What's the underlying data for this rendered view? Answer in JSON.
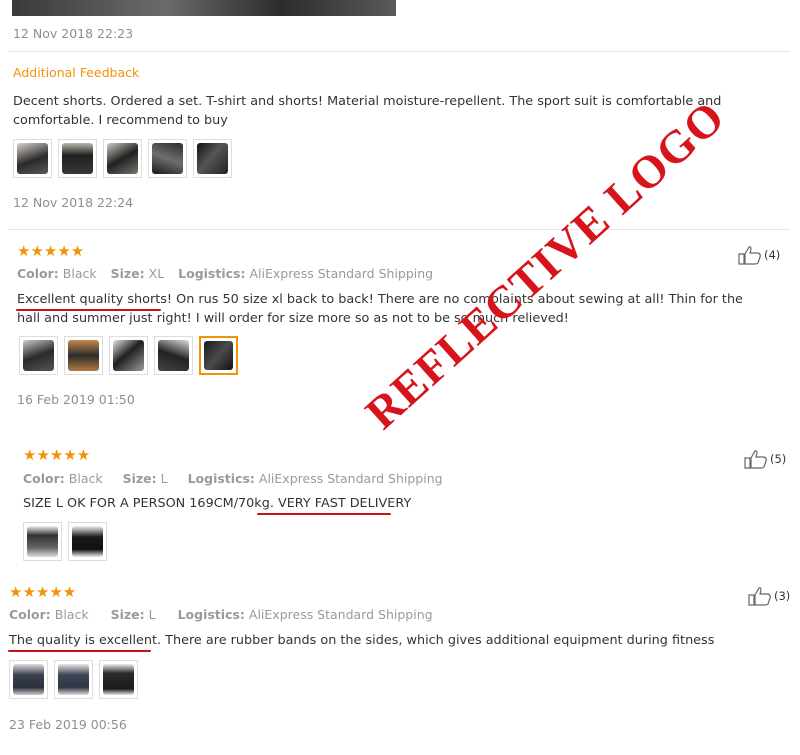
{
  "review0": {
    "date": "12 Nov 2018 22:23",
    "additional_feedback_title": "Additional Feedback",
    "additional_text": "Decent shorts. Ordered a set. T-shirt and shorts! Material moisture-repellent. The sport suit is comfortable and comfortable. I recommend to buy",
    "additional_date": "12 Nov 2018 22:24"
  },
  "review1": {
    "stars": "★★★★★",
    "color_label": "Color:",
    "color_value": "Black",
    "size_label": "Size:",
    "size_value": "XL",
    "logistics_label": "Logistics:",
    "logistics_value": "AliExpress Standard Shipping",
    "text": "Excellent quality shorts! On rus 50 size xl back to back! There are no complaints about sewing at all! Thin for the hall and summer just right! I will order for size more so as not to be so much relieved!",
    "helpful_count": "(4)",
    "date": "16 Feb 2019 01:50"
  },
  "review2": {
    "stars": "★★★★★",
    "color_label": "Color:",
    "color_value": "Black",
    "size_label": "Size:",
    "size_value": "L",
    "logistics_label": "Logistics:",
    "logistics_value": "AliExpress Standard Shipping",
    "text": "SIZE L OK FOR A PERSON 169CM/70kg. VERY FAST DELIVERY",
    "helpful_count": "(5)"
  },
  "review3": {
    "stars": "★★★★★",
    "color_label": "Color:",
    "color_value": "Black",
    "size_label": "Size:",
    "size_value": "L",
    "logistics_label": "Logistics:",
    "logistics_value": "AliExpress Standard Shipping",
    "text": "The quality is excellent. There are rubber bands on the sides, which gives additional equipment during fitness",
    "helpful_count": "(3)",
    "date": "23 Feb 2019 00:56"
  },
  "watermark": "REFLECTIVE LOGO",
  "colors": {
    "accent": "#f29208",
    "underline": "#c8121b",
    "watermark": "#d7141b",
    "muted": "#8f8f8f"
  }
}
